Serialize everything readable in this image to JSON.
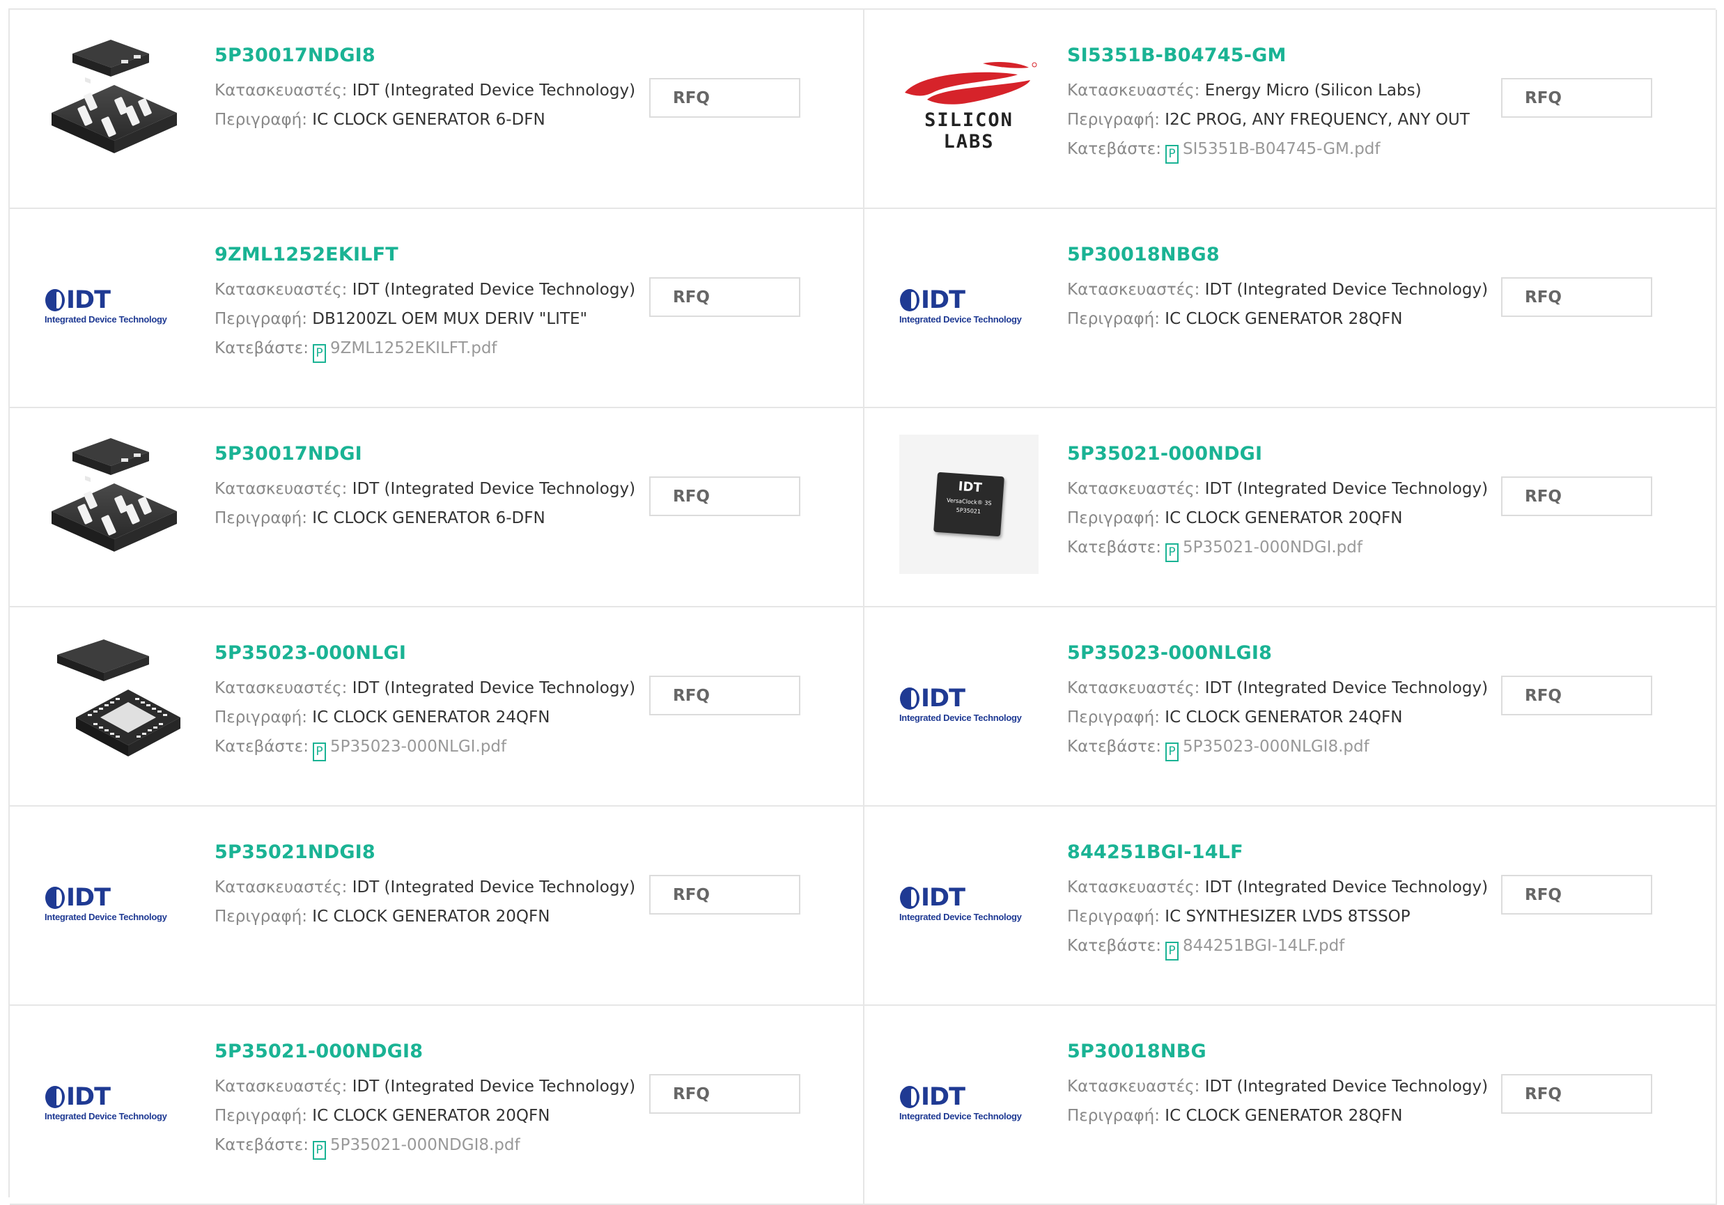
{
  "labels": {
    "manufacturer": "Κατασκευαστές:",
    "description": "Περιγραφή:",
    "download": "Κατεβάστε:",
    "rfq": "RFQ",
    "pdf_glyph": "P"
  },
  "logos": {
    "silicon_labs_text": "SILICON LABS",
    "idt_text": "IDT",
    "idt_tagline": "Integrated Device Technology",
    "chip_brand": "IDT",
    "chip_line1": "VersaClock® 3S",
    "chip_line2": "5P35021"
  },
  "colors": {
    "accent": "#1ab394",
    "idt_blue": "#1f3a93",
    "silicon_red": "#d6232a"
  },
  "products": [
    {
      "part": "5P30017NDGI8",
      "manufacturer": "IDT (Integrated Device Technology)",
      "description": "IC CLOCK GENERATOR 6-DFN",
      "pdf": "",
      "image": "dfn-package-icon"
    },
    {
      "part": "SI5351B-B04745-GM",
      "manufacturer": "Energy Micro (Silicon Labs)",
      "description": "I2C PROG, ANY FREQUENCY, ANY OUT",
      "pdf": "SI5351B-B04745-GM.pdf",
      "image": "silicon-labs-logo"
    },
    {
      "part": "9ZML1252EKILFT",
      "manufacturer": "IDT (Integrated Device Technology)",
      "description": "DB1200ZL OEM MUX DERIV \"LITE\"",
      "pdf": "9ZML1252EKILFT.pdf",
      "image": "idt-logo"
    },
    {
      "part": "5P30018NBG8",
      "manufacturer": "IDT (Integrated Device Technology)",
      "description": "IC CLOCK GENERATOR 28QFN",
      "pdf": "",
      "image": "idt-logo"
    },
    {
      "part": "5P30017NDGI",
      "manufacturer": "IDT (Integrated Device Technology)",
      "description": "IC CLOCK GENERATOR 6-DFN",
      "pdf": "",
      "image": "dfn-package-icon"
    },
    {
      "part": "5P35021-000NDGI",
      "manufacturer": "IDT (Integrated Device Technology)",
      "description": "IC CLOCK GENERATOR 20QFN",
      "pdf": "5P35021-000NDGI.pdf",
      "image": "versaclock-chip-photo"
    },
    {
      "part": "5P35023-000NLGI",
      "manufacturer": "IDT (Integrated Device Technology)",
      "description": "IC CLOCK GENERATOR 24QFN",
      "pdf": "5P35023-000NLGI.pdf",
      "image": "qfn-package-icon"
    },
    {
      "part": "5P35023-000NLGI8",
      "manufacturer": "IDT (Integrated Device Technology)",
      "description": "IC CLOCK GENERATOR 24QFN",
      "pdf": "5P35023-000NLGI8.pdf",
      "image": "idt-logo"
    },
    {
      "part": "5P35021NDGI8",
      "manufacturer": "IDT (Integrated Device Technology)",
      "description": "IC CLOCK GENERATOR 20QFN",
      "pdf": "",
      "image": "idt-logo"
    },
    {
      "part": "844251BGI-14LF",
      "manufacturer": "IDT (Integrated Device Technology)",
      "description": "IC SYNTHESIZER LVDS 8TSSOP",
      "pdf": "844251BGI-14LF.pdf",
      "image": "idt-logo"
    },
    {
      "part": "5P35021-000NDGI8",
      "manufacturer": "IDT (Integrated Device Technology)",
      "description": "IC CLOCK GENERATOR 20QFN",
      "pdf": "5P35021-000NDGI8.pdf",
      "image": "idt-logo"
    },
    {
      "part": "5P30018NBG",
      "manufacturer": "IDT (Integrated Device Technology)",
      "description": "IC CLOCK GENERATOR 28QFN",
      "pdf": "",
      "image": "idt-logo"
    }
  ]
}
